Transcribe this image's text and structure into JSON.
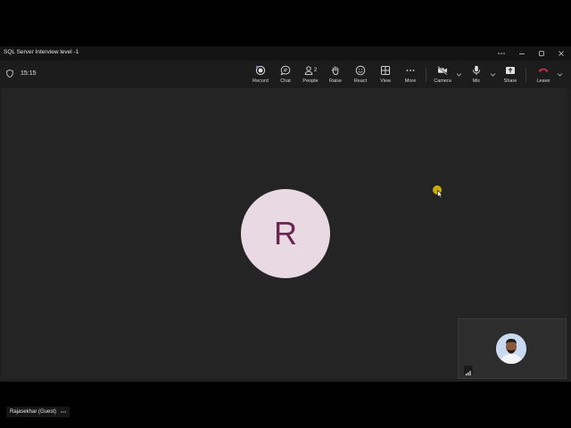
{
  "window": {
    "title": "SQL Server Interview level -1"
  },
  "header": {
    "timer": "15:15"
  },
  "toolbar": {
    "record": "Record",
    "chat": "Chat",
    "people": "People",
    "people_count": "2",
    "raise": "Raise",
    "react": "React",
    "view": "View",
    "more": "More",
    "camera": "Camera",
    "mic": "Mic",
    "share": "Share",
    "leave": "Leave"
  },
  "stage": {
    "avatar_initial": "R",
    "participant_name": "Rajasekhar (Guest)"
  },
  "colors": {
    "leave": "#c4314b",
    "avatar_bg": "#e9d9e3",
    "avatar_text": "#6a2550",
    "cursor_highlight": "#e6c800"
  }
}
